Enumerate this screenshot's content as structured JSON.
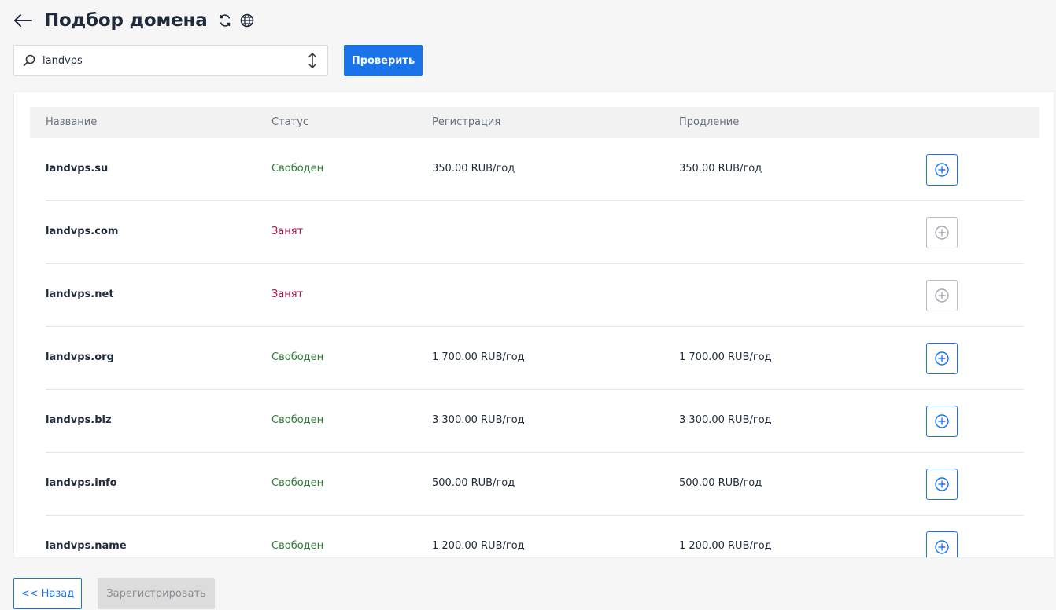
{
  "header": {
    "title": "Подбор домена"
  },
  "search": {
    "value": "landvps"
  },
  "check_button_label": "Проверить",
  "table": {
    "columns": {
      "name": "Название",
      "status": "Статус",
      "registration": "Регистрация",
      "renewal": "Продление"
    },
    "rows": [
      {
        "name": "landvps.su",
        "status": "Свободен",
        "registration": "350.00 RUB/год",
        "renewal": "350.00 RUB/год"
      },
      {
        "name": "landvps.com",
        "status": "Занят",
        "registration": "",
        "renewal": ""
      },
      {
        "name": "landvps.net",
        "status": "Занят",
        "registration": "",
        "renewal": ""
      },
      {
        "name": "landvps.org",
        "status": "Свободен",
        "registration": "1 700.00 RUB/год",
        "renewal": "1 700.00 RUB/год"
      },
      {
        "name": "landvps.biz",
        "status": "Свободен",
        "registration": "3 300.00 RUB/год",
        "renewal": "3 300.00 RUB/год"
      },
      {
        "name": "landvps.info",
        "status": "Свободен",
        "registration": "500.00 RUB/год",
        "renewal": "500.00 RUB/год"
      },
      {
        "name": "landvps.name",
        "status": "Свободен",
        "registration": "1 200.00 RUB/год",
        "renewal": "1 200.00 RUB/год"
      }
    ]
  },
  "footer": {
    "back_label": "<< Назад",
    "register_label": "Зарегистрировать"
  },
  "colors": {
    "accent": "#1a73e8",
    "status_free": "#2e7d32",
    "status_taken": "#b0174f",
    "disabled": "#dcdcdc"
  },
  "icons": {
    "back": "arrow-left-icon",
    "refresh": "refresh-icon",
    "globe": "globe-icon",
    "search": "search-icon",
    "sort": "sort-vertical-icon",
    "add": "plus-circle-icon"
  }
}
